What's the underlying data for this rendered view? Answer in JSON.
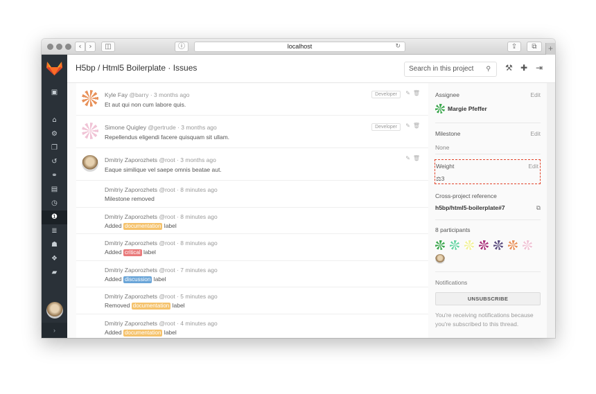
{
  "browser": {
    "url": "localhost",
    "nav_back": "‹",
    "nav_forward": "›",
    "sidebar_glyph": "◫",
    "shield_glyph": "ⓘ",
    "reload_glyph": "↻",
    "share_glyph": "⇪",
    "tabs_glyph": "⧉",
    "newtab_glyph": "+"
  },
  "header": {
    "title": "H5bp / Html5 Boilerplate · Issues",
    "search_placeholder": "Search in this project",
    "search_glyph": "⚲",
    "wrench_glyph": "⚒",
    "plus_glyph": "✚",
    "signout_glyph": "⇥"
  },
  "nav": {
    "icons": [
      {
        "name": "activity-icon",
        "glyph": "▣"
      },
      {
        "name": "home-icon",
        "glyph": "⌂"
      },
      {
        "name": "group-icon",
        "glyph": "⚙"
      },
      {
        "name": "files-icon",
        "glyph": "❐"
      },
      {
        "name": "history-icon",
        "glyph": "↺"
      },
      {
        "name": "network-icon",
        "glyph": "⚭"
      },
      {
        "name": "graph-icon",
        "glyph": "▤"
      },
      {
        "name": "milestone-icon",
        "glyph": "◷"
      },
      {
        "name": "issues-icon",
        "glyph": "❶"
      },
      {
        "name": "merge-requests-icon",
        "glyph": "≣"
      },
      {
        "name": "members-icon",
        "glyph": "☗"
      },
      {
        "name": "labels-icon",
        "glyph": "❖"
      },
      {
        "name": "wiki-icon",
        "glyph": "▰"
      }
    ],
    "collapse_glyph": "›"
  },
  "notes": [
    {
      "author": "Kyle Fay",
      "handle": "@barry",
      "time": "· 3 months ago",
      "text": "Et aut qui non cum labore quis.",
      "role": "Developer"
    },
    {
      "author": "Simone Quigley",
      "handle": "@gertrude",
      "time": "· 3 months ago",
      "text": "Repellendus eligendi facere quisquam sit ullam.",
      "role": "Developer"
    },
    {
      "author": "Dmitriy Zaporozhets",
      "handle": "@root",
      "time": "· 3 months ago",
      "text": "Eaque similique vel saepe omnis beatae aut."
    }
  ],
  "events": [
    {
      "author": "Dmitriy Zaporozhets",
      "handle": "@root",
      "time": "· 8 minutes ago",
      "prefix": "Milestone removed",
      "label": "",
      "suffix": "",
      "color": ""
    },
    {
      "author": "Dmitriy Zaporozhets",
      "handle": "@root",
      "time": "· 8 minutes ago",
      "prefix": "Added ",
      "label": "documentation",
      "suffix": " label",
      "color": "#f5c26b"
    },
    {
      "author": "Dmitriy Zaporozhets",
      "handle": "@root",
      "time": "· 8 minutes ago",
      "prefix": "Added ",
      "label": "critical",
      "suffix": " label",
      "color": "#e9797a"
    },
    {
      "author": "Dmitriy Zaporozhets",
      "handle": "@root",
      "time": "· 7 minutes ago",
      "prefix": "Added ",
      "label": "discussion",
      "suffix": " label",
      "color": "#6aa5d8"
    },
    {
      "author": "Dmitriy Zaporozhets",
      "handle": "@root",
      "time": "· 5 minutes ago",
      "prefix": "Removed ",
      "label": "documentation",
      "suffix": " label",
      "color": "#f5c26b"
    },
    {
      "author": "Dmitriy Zaporozhets",
      "handle": "@root",
      "time": "· 4 minutes ago",
      "prefix": "Added ",
      "label": "documentation",
      "suffix": " label",
      "color": "#f5c26b"
    }
  ],
  "sidebar": {
    "assignee_label": "Assignee",
    "assignee_edit": "Edit",
    "assignee_name": "Margie Pfeffer",
    "milestone_label": "Milestone",
    "milestone_edit": "Edit",
    "milestone_value": "None",
    "weight_label": "Weight",
    "weight_edit": "Edit",
    "weight_value": "3",
    "weight_glyph": "⚖",
    "xref_label": "Cross-project reference",
    "xref_value": "h5bp/html5-boilerplate#7",
    "copy_glyph": "⧉",
    "participants_label": "8 participants",
    "notifications_label": "Notifications",
    "unsubscribe": "UNSUBSCRIBE",
    "notify_line1": "You're receiving notifications because",
    "notify_line2": "you're subscribed to this thread."
  },
  "colors": {
    "nav_bg": "#2a3138",
    "logo_orange": "#fc6d26",
    "weight_border": "#e24329"
  }
}
